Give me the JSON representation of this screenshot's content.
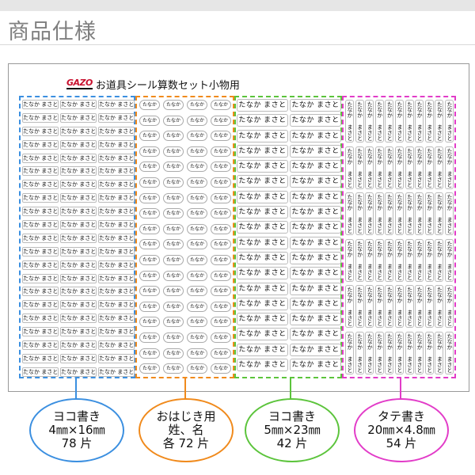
{
  "page": {
    "heading": "商品仕様"
  },
  "sheet": {
    "logo": "GAZO",
    "title": "お道具シール算数セット小物用"
  },
  "label_text": {
    "horizontal_small": "たなか まさと",
    "round": "たなか",
    "horizontal_large": "たなか まさと",
    "vertical": "たなか まさと"
  },
  "callouts": [
    {
      "lines": [
        "ヨコ書き",
        "4㎜×16㎜",
        "78 片"
      ],
      "color": "#3b8fe0"
    },
    {
      "lines": [
        "おはじき用",
        "姓、名",
        "各 72 片"
      ],
      "color": "#f08a1c"
    },
    {
      "lines": [
        "ヨコ書き",
        "5㎜×23㎜",
        "42 片"
      ],
      "color": "#5cc43c"
    },
    {
      "lines": [
        "タテ書き",
        "20㎜×4.8㎜",
        "54 片"
      ],
      "color": "#e23cc8"
    }
  ]
}
